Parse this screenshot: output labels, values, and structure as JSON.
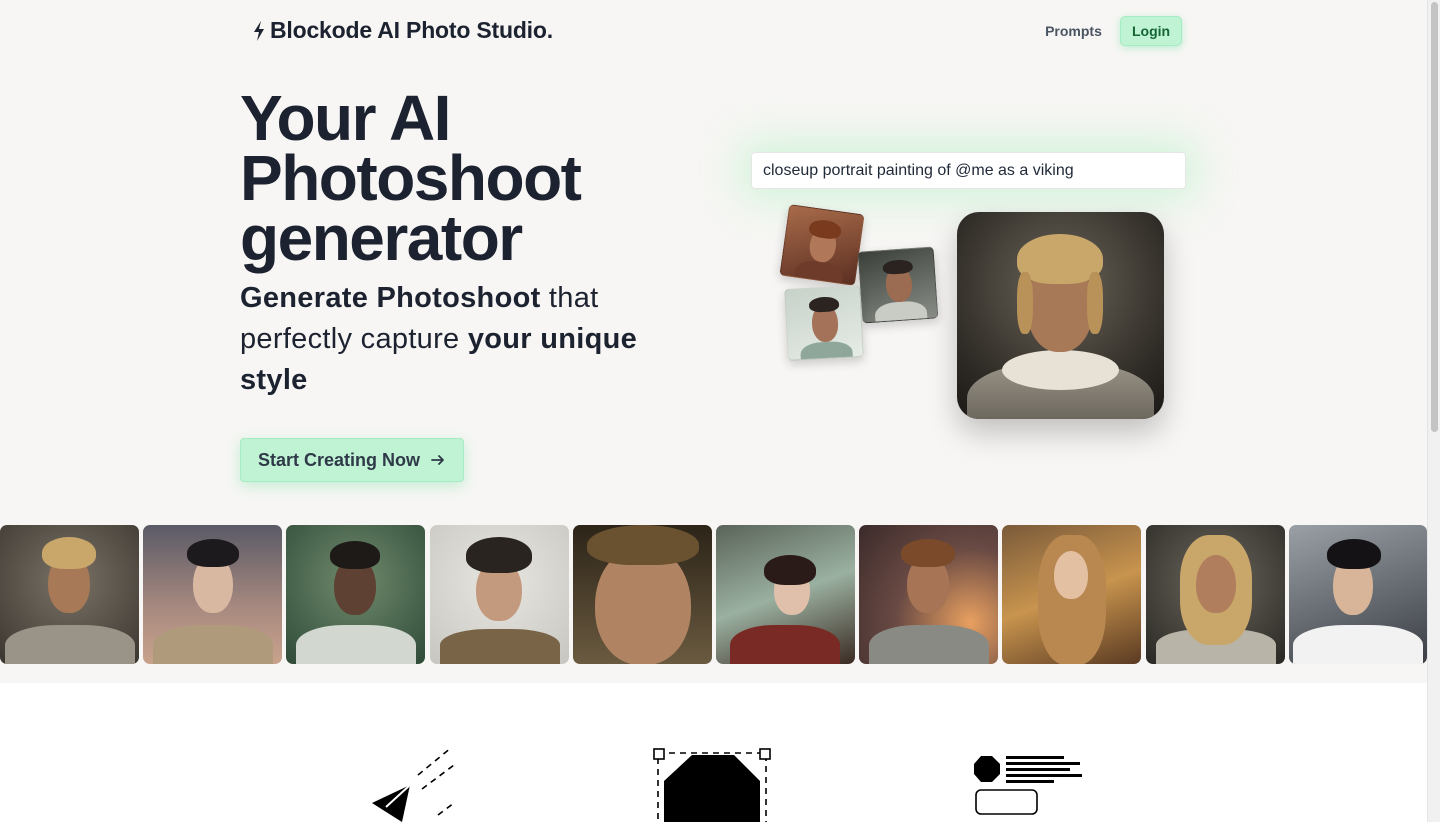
{
  "header": {
    "logo_text": "Blockode AI Photo Studio.",
    "logo_icon": "bolt-icon",
    "nav": {
      "prompts_label": "Prompts",
      "login_label": "Login"
    }
  },
  "hero": {
    "title": "Your AI Photoshoot generator",
    "subtitle_parts": {
      "bold1": "Generate Photoshoot",
      "plain1": " that perfectly capture ",
      "bold2": "your unique style"
    },
    "cta_label": "Start Creating Now",
    "cta_icon": "arrow-right-icon"
  },
  "demo": {
    "prompt_value": "closeup portrait painting of @me as a viking"
  },
  "colors": {
    "accent_bg": "#bff3d4",
    "accent_text": "#166534",
    "ink": "#1c2230"
  },
  "features": {
    "icons": [
      "paper-plane-icon",
      "octagon-selection-icon",
      "layout-card-icon"
    ]
  }
}
